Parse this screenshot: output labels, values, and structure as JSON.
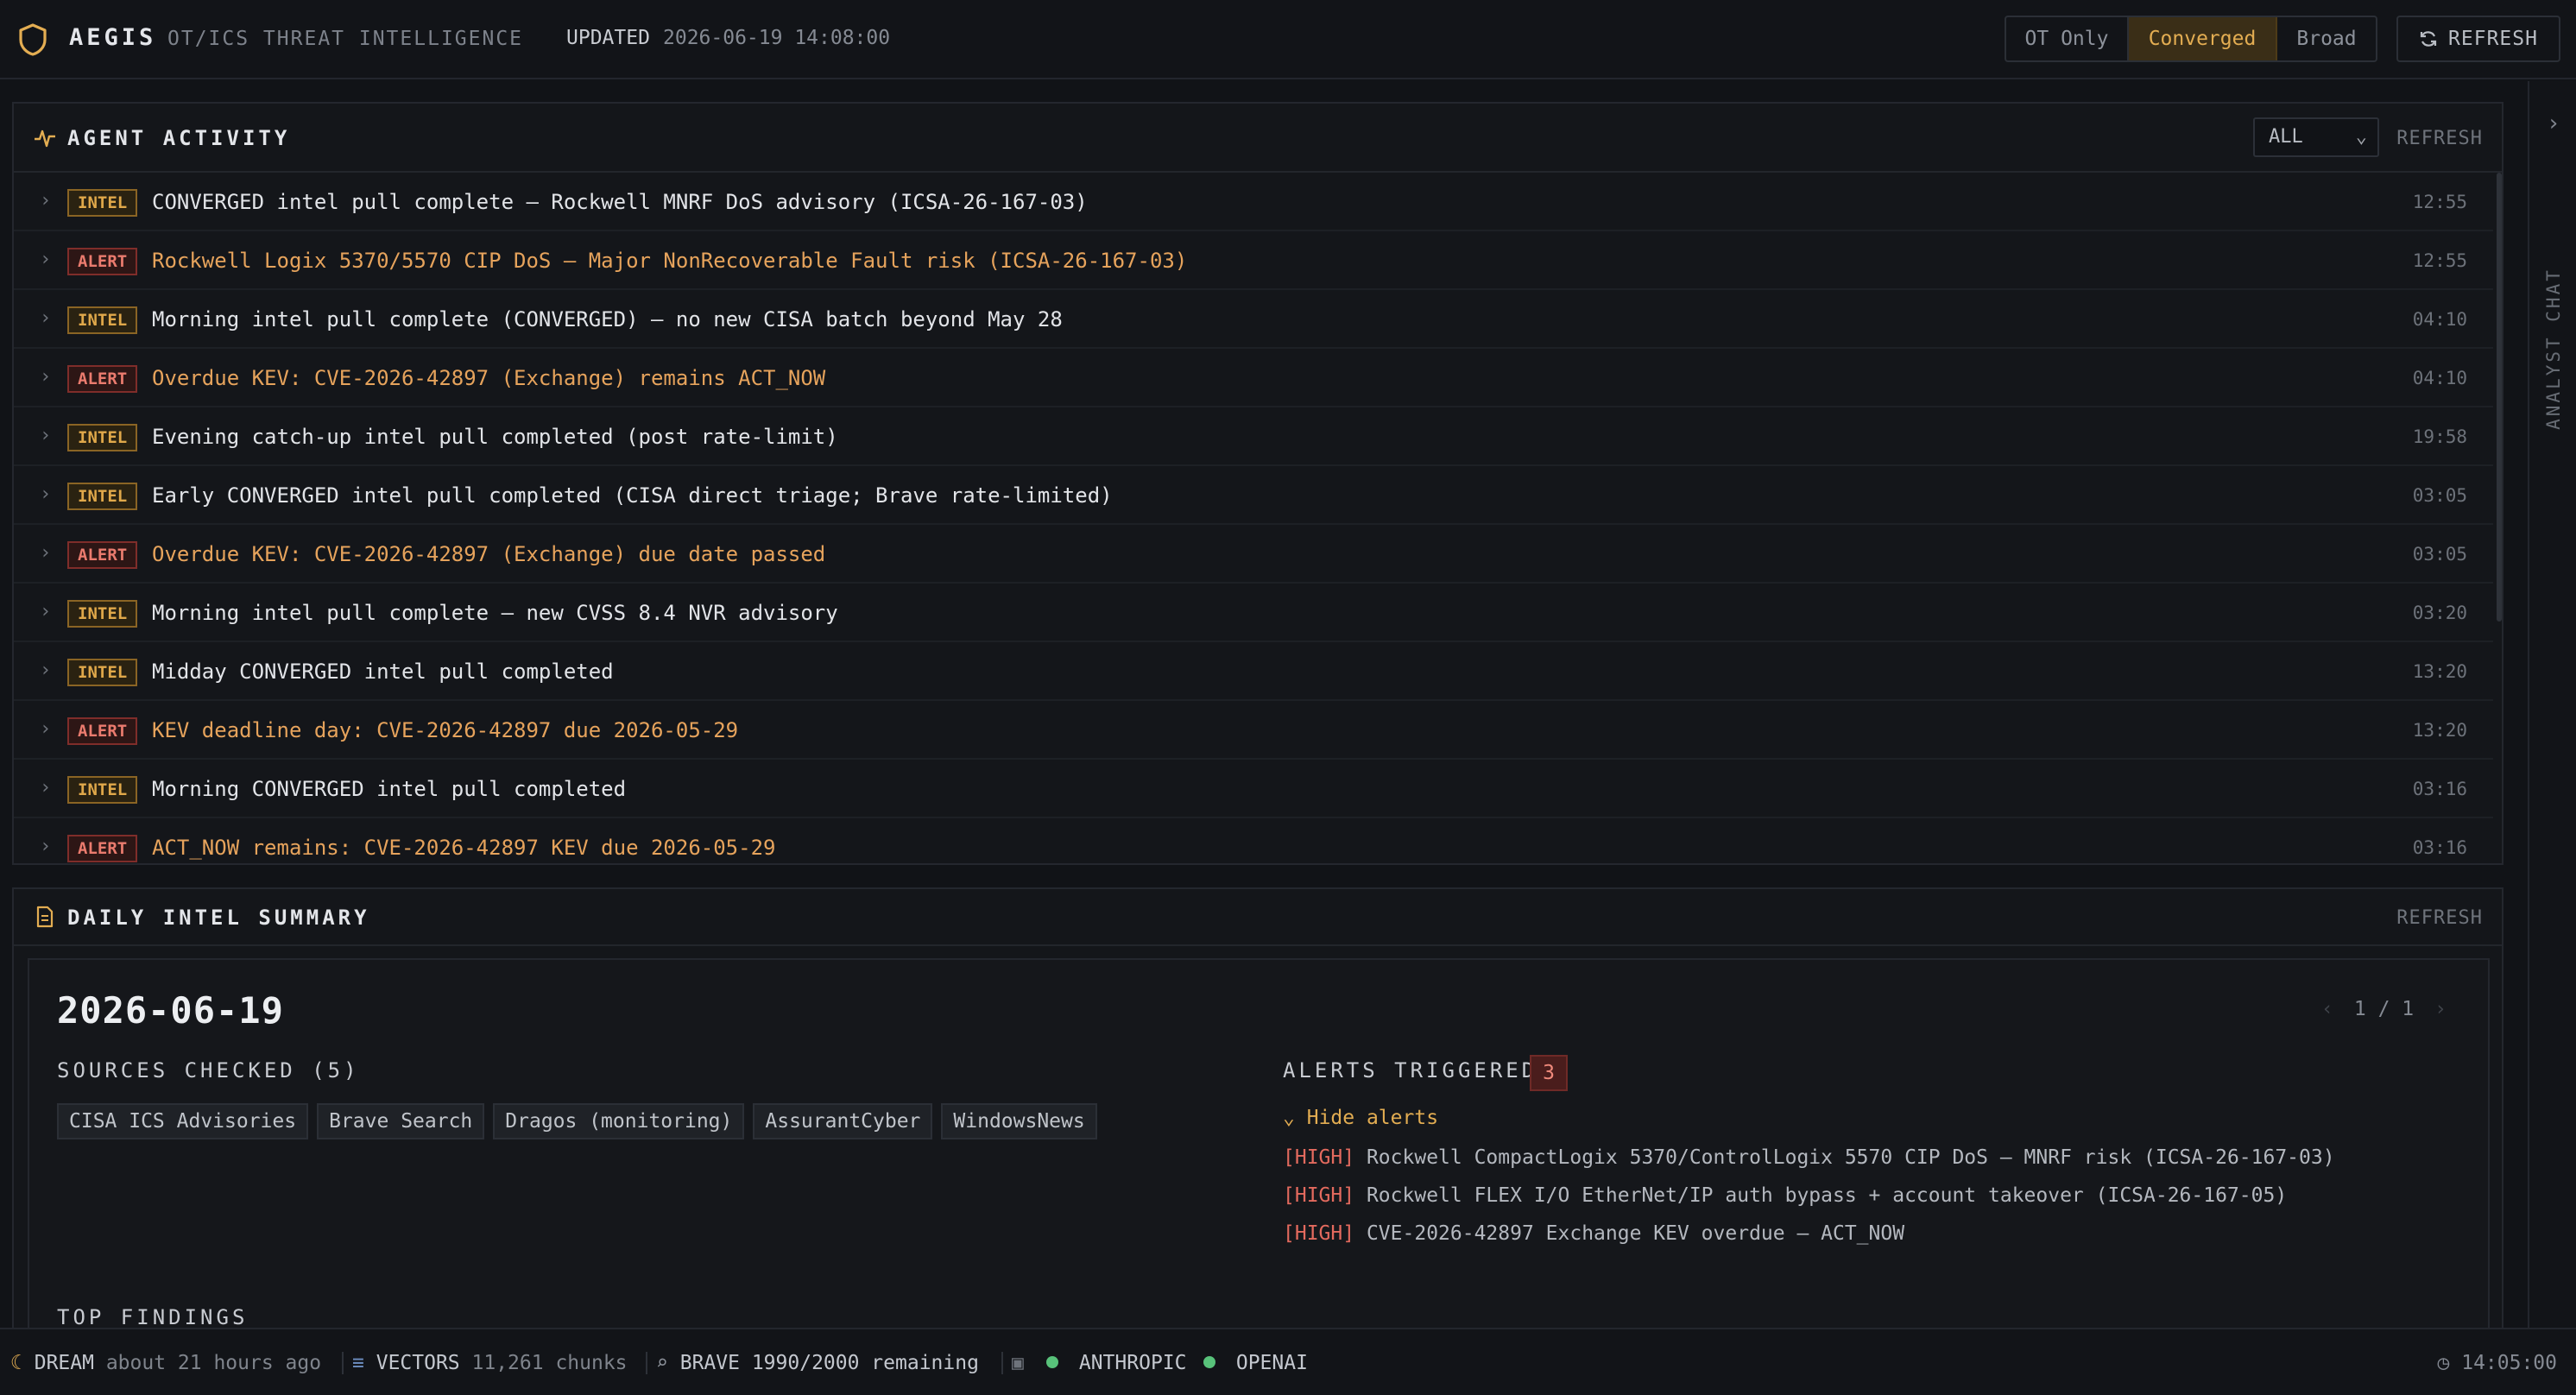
{
  "header": {
    "brand": "AEGIS",
    "subtitle": "OT/ICS THREAT INTELLIGENCE",
    "updated_label": "UPDATED",
    "updated_value": "2026-06-19 14:08:00",
    "modes": [
      "OT Only",
      "Converged",
      "Broad"
    ],
    "active_mode": "Converged",
    "refresh_label": "REFRESH",
    "accent_color": "#e3ad52"
  },
  "activity": {
    "title": "AGENT ACTIVITY",
    "filter_value": "ALL",
    "refresh_label": "REFRESH",
    "rows": [
      {
        "type": "INTEL",
        "text": "CONVERGED intel pull complete — Rockwell MNRF DoS advisory (ICSA-26-167-03)",
        "time": "12:55"
      },
      {
        "type": "ALERT",
        "text": "Rockwell Logix 5370/5570 CIP DoS — Major NonRecoverable Fault risk (ICSA-26-167-03)",
        "time": "12:55"
      },
      {
        "type": "INTEL",
        "text": "Morning intel pull complete (CONVERGED) — no new CISA batch beyond May 28",
        "time": "04:10"
      },
      {
        "type": "ALERT",
        "text": "Overdue KEV: CVE-2026-42897 (Exchange) remains ACT_NOW",
        "time": "04:10"
      },
      {
        "type": "INTEL",
        "text": "Evening catch-up intel pull completed (post rate-limit)",
        "time": "19:58"
      },
      {
        "type": "INTEL",
        "text": "Early CONVERGED intel pull completed (CISA direct triage; Brave rate-limited)",
        "time": "03:05"
      },
      {
        "type": "ALERT",
        "text": "Overdue KEV: CVE-2026-42897 (Exchange) due date passed",
        "time": "03:05"
      },
      {
        "type": "INTEL",
        "text": "Morning intel pull complete — new CVSS 8.4 NVR advisory",
        "time": "03:20"
      },
      {
        "type": "INTEL",
        "text": "Midday CONVERGED intel pull completed",
        "time": "13:20"
      },
      {
        "type": "ALERT",
        "text": "KEV deadline day: CVE-2026-42897 due 2026-05-29",
        "time": "13:20"
      },
      {
        "type": "INTEL",
        "text": "Morning CONVERGED intel pull completed",
        "time": "03:16"
      },
      {
        "type": "ALERT",
        "text": "ACT_NOW remains: CVE-2026-42897 KEV due 2026-05-29",
        "time": "03:16"
      }
    ]
  },
  "summary": {
    "title": "DAILY INTEL SUMMARY",
    "refresh_label": "REFRESH",
    "date": "2026-06-19",
    "pager": "1 / 1",
    "sources_label": "SOURCES CHECKED (5)",
    "sources": [
      "CISA ICS Advisories",
      "Brave Search",
      "Dragos (monitoring)",
      "AssurantCyber",
      "WindowsNews"
    ],
    "alerts_label": "ALERTS TRIGGERED",
    "alerts_count": "3",
    "hide_alerts_label": "Hide alerts",
    "alerts": [
      {
        "severity": "[HIGH]",
        "text": "Rockwell CompactLogix 5370/ControlLogix 5570 CIP DoS — MNRF risk (ICSA-26-167-03)"
      },
      {
        "severity": "[HIGH]",
        "text": "Rockwell FLEX I/O EtherNet/IP auth bypass + account takeover (ICSA-26-167-05)"
      },
      {
        "severity": "[HIGH]",
        "text": "CVE-2026-42897 Exchange KEV overdue — ACT_NOW"
      }
    ],
    "top_findings_label": "TOP FINDINGS"
  },
  "rail": {
    "label": "ANALYST CHAT"
  },
  "status": {
    "dream_label": "DREAM",
    "dream_value": "about 21 hours ago",
    "vectors_label": "VECTORS",
    "vectors_value": "11,261 chunks",
    "brave_label": "BRAVE",
    "brave_value": "1990/2000 remaining",
    "anthropic_label": "ANTHROPIC",
    "openai_label": "OPENAI",
    "ok_color": "#58c27a",
    "clock": "14:05:00"
  }
}
